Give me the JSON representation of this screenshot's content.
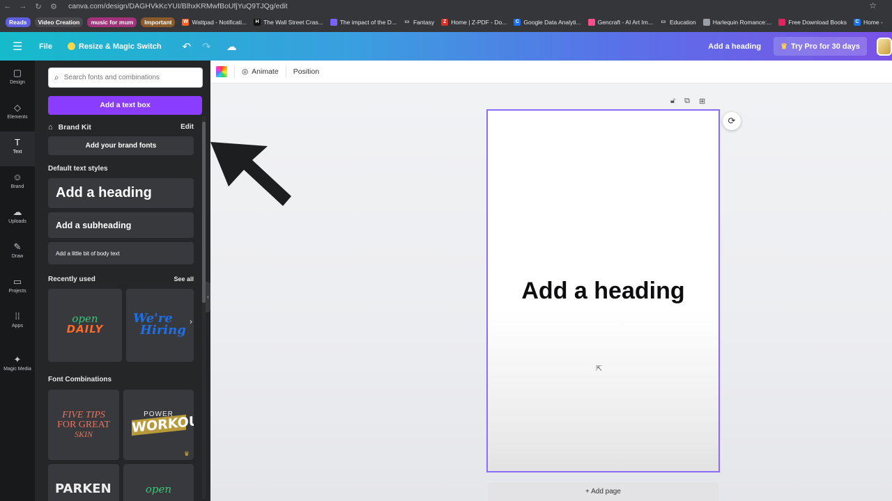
{
  "browser": {
    "url": "canva.com/design/DAGHVkKcYUI/BlhxKRMwfBoUfjYuQ9TJQg/edit",
    "bookmark_chips": [
      {
        "label": "Reads",
        "color": "#5d5fe0"
      },
      {
        "label": "Video Creation",
        "color": "#4a4a4e"
      },
      {
        "label": "music for mum",
        "color": "#a2337a"
      },
      {
        "label": "Important",
        "color": "#8a5a2a"
      }
    ],
    "bookmarks": [
      {
        "label": "Wattpad - Notificati...",
        "icon_color": "#ff6122",
        "icon": "W"
      },
      {
        "label": "The Wall Street Cras...",
        "icon_color": "#111111",
        "icon": "H"
      },
      {
        "label": "The impact of the D...",
        "icon_color": "#7b61ff",
        "icon": ""
      },
      {
        "label": "Fantasy",
        "icon_color": "#35363a",
        "icon": "folder"
      },
      {
        "label": "Home | Z-PDF - Do...",
        "icon_color": "#d93025",
        "icon": "Z"
      },
      {
        "label": "Google Data Analyti...",
        "icon_color": "#1a73e8",
        "icon": "C"
      },
      {
        "label": "Gencraft - AI Art Im...",
        "icon_color": "#ff4f8b",
        "icon": ""
      },
      {
        "label": "Education",
        "icon_color": "#35363a",
        "icon": "folder"
      },
      {
        "label": "Harlequin Romance:...",
        "icon_color": "#9aa0a6",
        "icon": ""
      },
      {
        "label": "Free Download Books",
        "icon_color": "#e0245e",
        "icon": ""
      },
      {
        "label": "Home -",
        "icon_color": "#1a73e8",
        "icon": "C"
      }
    ]
  },
  "topbar": {
    "file_label": "File",
    "magic_label": "Resize & Magic Switch",
    "design_title": "Add a heading",
    "try_pro_label": "Try Pro for 30 days"
  },
  "rail": {
    "items": [
      {
        "label": "Design",
        "icon": "▢"
      },
      {
        "label": "Elements",
        "icon": "◇"
      },
      {
        "label": "Text",
        "icon": "T"
      },
      {
        "label": "Brand",
        "icon": "☺"
      },
      {
        "label": "Uploads",
        "icon": "☁"
      },
      {
        "label": "Draw",
        "icon": "✎"
      },
      {
        "label": "Projects",
        "icon": "▭"
      },
      {
        "label": "Apps",
        "icon": "⁞⁞"
      },
      {
        "label": "Magic Media",
        "icon": "✦"
      }
    ],
    "active_index": 2
  },
  "panel": {
    "search_placeholder": "Search fonts and combinations",
    "add_text_box": "Add a text box",
    "brand_kit": "Brand Kit",
    "brand_kit_edit": "Edit",
    "add_brand_fonts": "Add your brand fonts",
    "default_styles_title": "Default text styles",
    "heading_style": "Add a heading",
    "subheading_style": "Add a subheading",
    "body_style": "Add a little bit of body text",
    "recently_used_title": "Recently used",
    "see_all": "See all",
    "recent": [
      {
        "top": "open",
        "bottom": "DAILY"
      },
      {
        "line1": "We're",
        "line2": "Hiring"
      }
    ],
    "font_combinations_title": "Font Combinations",
    "combos": [
      {
        "lines": [
          "FIVE TIPS",
          "FOR GREAT",
          "SKIN"
        ]
      },
      {
        "top": "POWER",
        "main": "WORKOUT"
      },
      {
        "main": "PARKEN"
      },
      {
        "main": "open"
      }
    ]
  },
  "toolbar": {
    "animate": "Animate",
    "position": "Position"
  },
  "canvas": {
    "heading": "Add a heading",
    "add_page": "+ Add page"
  },
  "colors": {
    "canva_purple": "#8b3dff",
    "topbar_start": "#15bbcb",
    "topbar_end": "#7a53e6",
    "selection_outline": "#8b6bff"
  }
}
